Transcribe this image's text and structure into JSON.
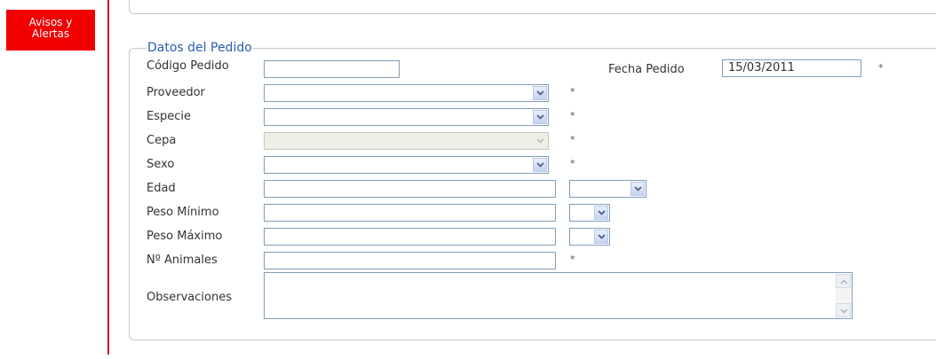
{
  "sidebar": {
    "alerts_button_line1": "Avisos y",
    "alerts_button_line2": "Alertas"
  },
  "form": {
    "legend": "Datos del Pedido",
    "codigo_label": "Código Pedido",
    "codigo_value": "",
    "fecha_label": "Fecha Pedido",
    "fecha_value": "15/03/2011",
    "proveedor_label": "Proveedor",
    "especie_label": "Especie",
    "cepa_label": "Cepa",
    "sexo_label": "Sexo",
    "edad_label": "Edad",
    "peso_min_label": "Peso Mínimo",
    "peso_max_label": "Peso Máximo",
    "animales_label": "Nº Animales",
    "observaciones_label": "Observaciones",
    "required_mark": "*"
  },
  "colors": {
    "accent_red": "#f20000",
    "legend_blue": "#2a5db0",
    "border": "#7f9db9"
  }
}
